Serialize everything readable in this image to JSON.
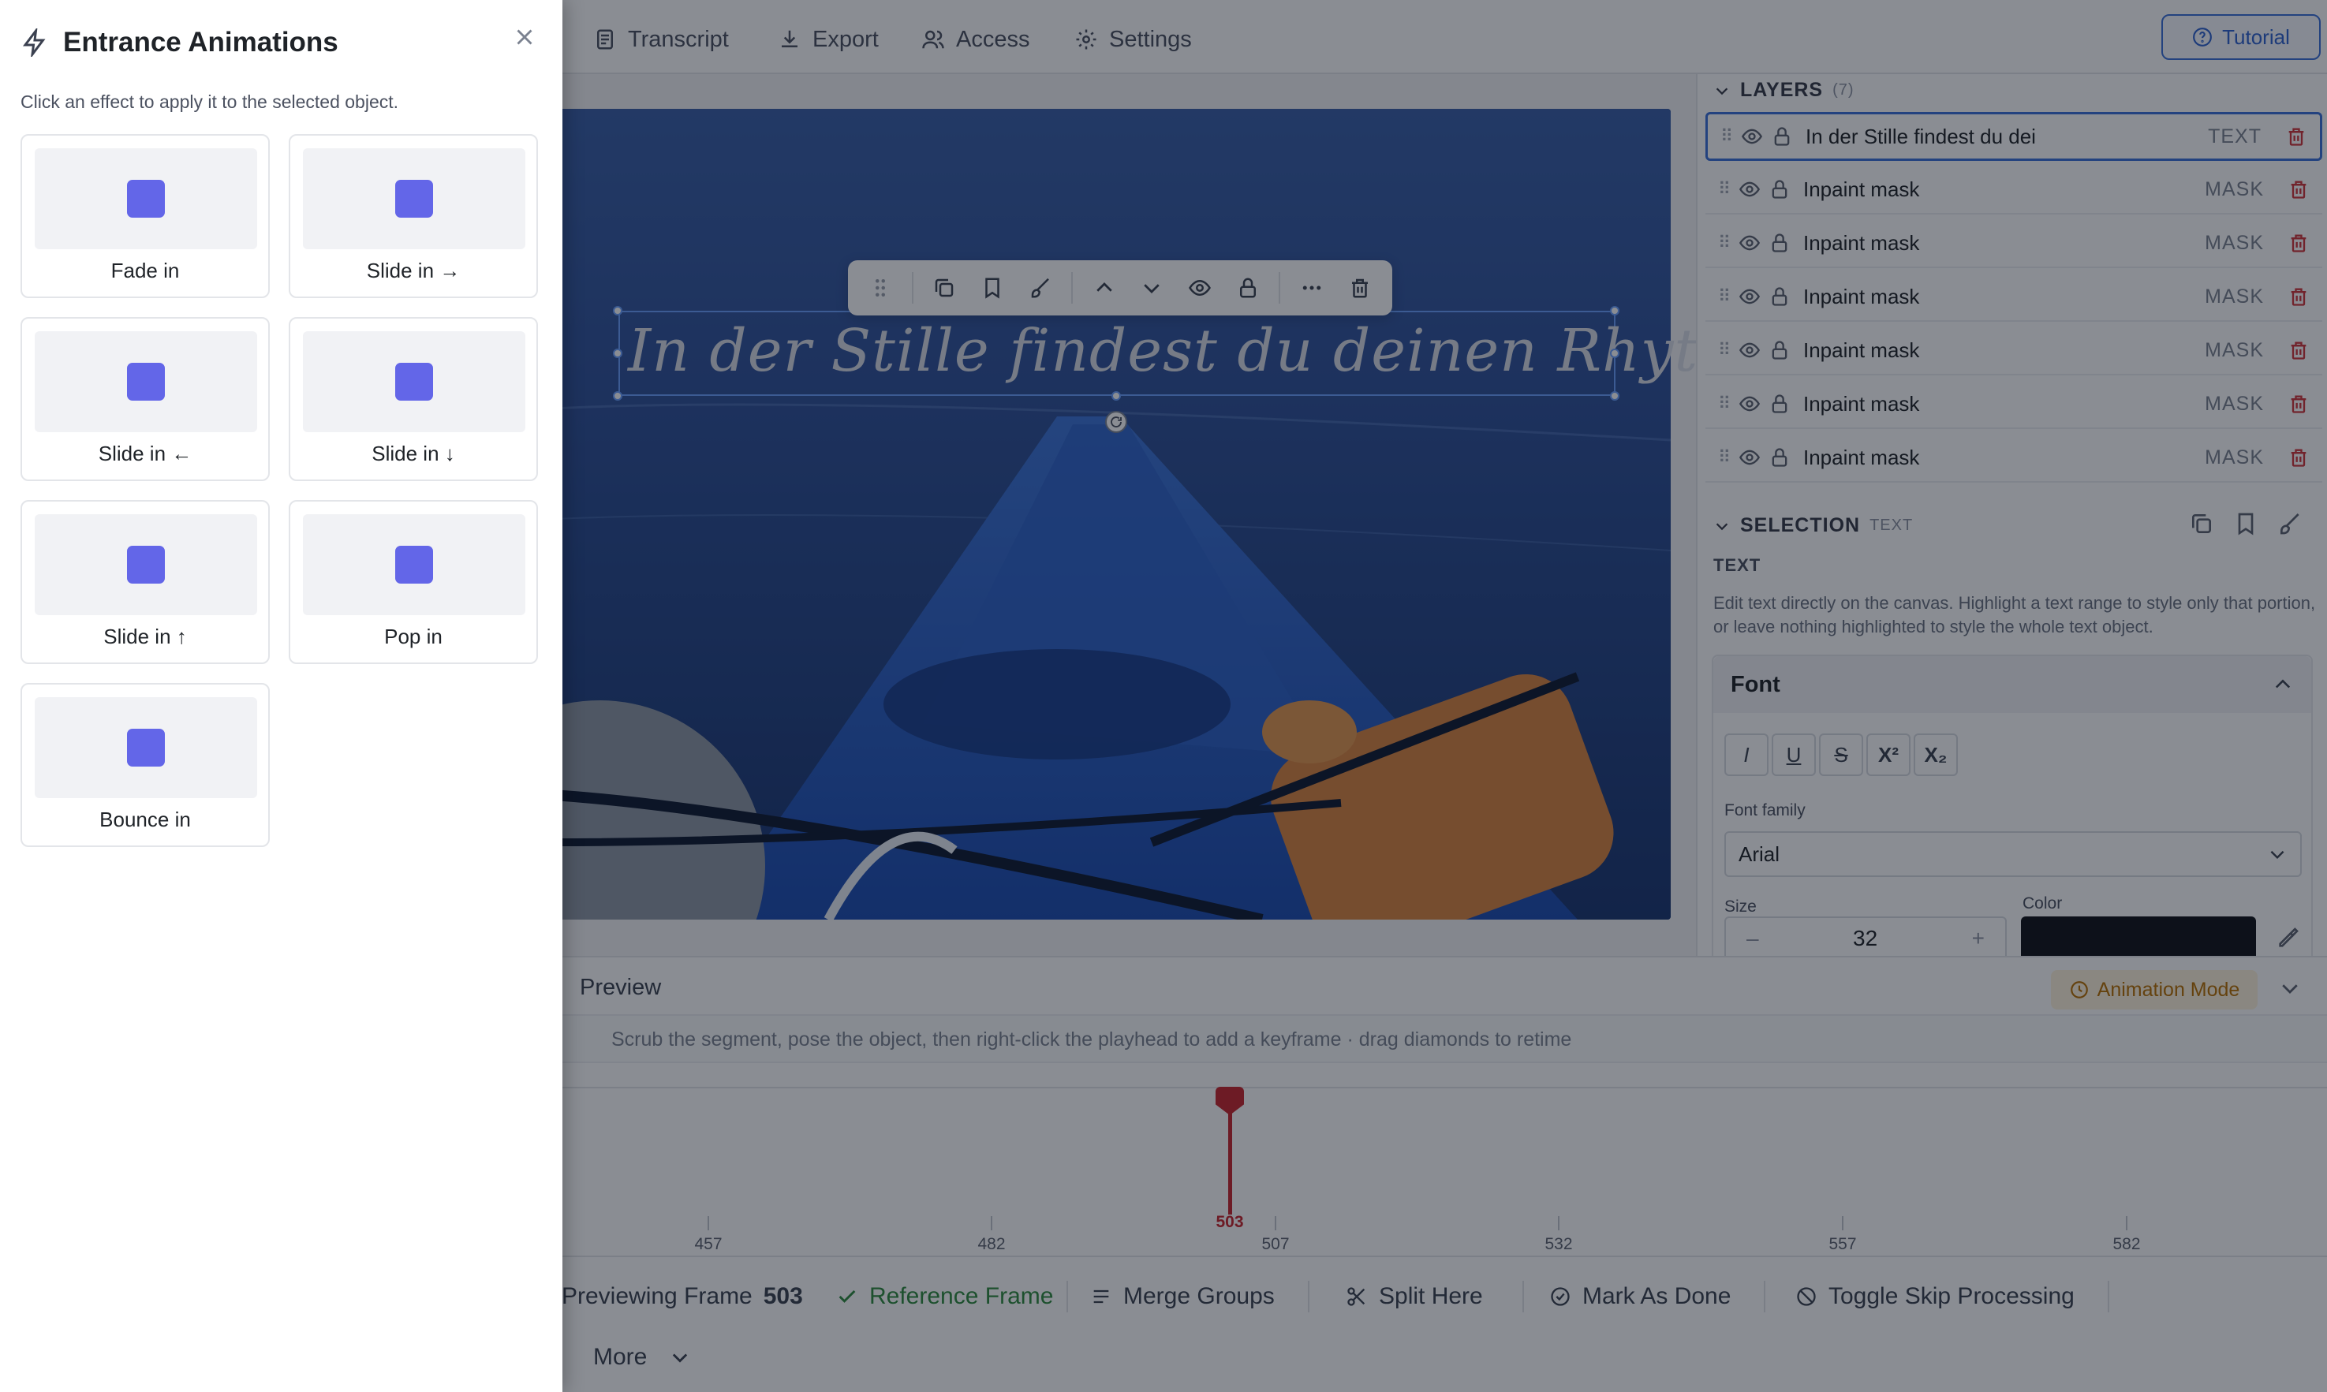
{
  "tabs": [
    "Transcript",
    "Export",
    "Access",
    "Settings"
  ],
  "tutorial_label": "Tutorial",
  "canvas": {
    "caption": "In der Stille findest du deinen Rhythmus."
  },
  "layers": {
    "title": "LAYERS",
    "count": "(7)",
    "items": [
      {
        "name": "In der Stille findest du dei",
        "type": "TEXT"
      },
      {
        "name": "Inpaint mask",
        "type": "MASK"
      },
      {
        "name": "Inpaint mask",
        "type": "MASK"
      },
      {
        "name": "Inpaint mask",
        "type": "MASK"
      },
      {
        "name": "Inpaint mask",
        "type": "MASK"
      },
      {
        "name": "Inpaint mask",
        "type": "MASK"
      },
      {
        "name": "Inpaint mask",
        "type": "MASK"
      }
    ]
  },
  "selection": {
    "title": "SELECTION",
    "kind": "TEXT",
    "subheading": "TEXT",
    "help_line1": "Edit text directly on the canvas. Highlight a text range to style only that portion,",
    "help_line2": "or leave nothing highlighted to style the whole text object.",
    "font_section": "Font",
    "format_buttons": [
      "I",
      "U",
      "S",
      "X²",
      "X₂"
    ],
    "font_family_label": "Font family",
    "font_family_value": "Arial",
    "size_label": "Size",
    "size_value": "32",
    "size_minus": "–",
    "size_plus": "+",
    "color_label": "Color",
    "color_value": "#111318"
  },
  "preview": {
    "title": "Preview",
    "animation_mode": "Animation Mode",
    "hint": "Scrub the segment, pose the object, then right-click the playhead to add a keyframe · drag diamonds to retime",
    "ticks": [
      "457",
      "482",
      "507",
      "532",
      "557",
      "582"
    ],
    "playhead_frame": "503"
  },
  "actions": {
    "previewing_prefix": "Previewing Frame",
    "previewing_frame": "503",
    "reference_frame": "Reference Frame",
    "merge_groups": "Merge Groups",
    "split_here": "Split Here",
    "mark_as_done": "Mark As Done",
    "toggle_skip": "Toggle Skip Processing",
    "more": "More"
  },
  "drawer": {
    "title": "Entrance Animations",
    "description": "Click an effect to apply it to the selected object.",
    "effects": [
      "Fade in",
      "Slide in →",
      "Slide in ←",
      "Slide in ↓",
      "Slide in ↑",
      "Pop in",
      "Bounce in"
    ],
    "effect_color": "#6366e8"
  }
}
